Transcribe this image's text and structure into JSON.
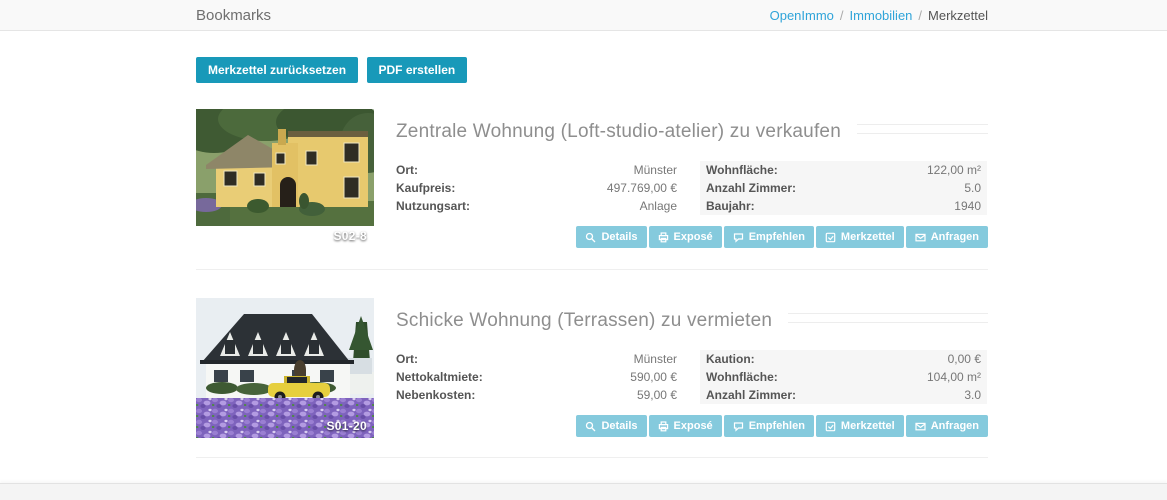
{
  "header": {
    "title": "Bookmarks",
    "separator": "/",
    "breadcrumb": [
      {
        "label": "OpenImmo"
      },
      {
        "label": "Immobilien"
      },
      {
        "label": "Merkzettel"
      }
    ]
  },
  "toolbar": {
    "reset_label": "Merkzettel zurücksetzen",
    "pdf_label": "PDF erstellen"
  },
  "listings": [
    {
      "title": "Zentrale Wohnung (Loft-studio-atelier) zu verkaufen",
      "photo_label": "S02-8",
      "details_left": [
        {
          "label": "Ort:",
          "value": "Münster"
        },
        {
          "label": "Kaufpreis:",
          "value": "497.769,00 €"
        },
        {
          "label": "Nutzungsart:",
          "value": "Anlage"
        }
      ],
      "details_right": [
        {
          "label": "Wohnfläche:",
          "value": "122,00 m²"
        },
        {
          "label": "Anzahl Zimmer:",
          "value": "5.0"
        },
        {
          "label": "Baujahr:",
          "value": "1940"
        }
      ]
    },
    {
      "title": "Schicke Wohnung (Terrassen) zu vermieten",
      "photo_label": "S01-20",
      "details_left": [
        {
          "label": "Ort:",
          "value": "Münster"
        },
        {
          "label": "Nettokaltmiete:",
          "value": "590,00 €"
        },
        {
          "label": "Nebenkosten:",
          "value": "59,00 €"
        }
      ],
      "details_right": [
        {
          "label": "Kaution:",
          "value": "0,00 €"
        },
        {
          "label": "Wohnfläche:",
          "value": "104,00 m²"
        },
        {
          "label": "Anzahl Zimmer:",
          "value": "3.0"
        }
      ]
    }
  ],
  "actions": [
    {
      "label": "Details",
      "icon": "magnifier-icon"
    },
    {
      "label": "Exposé",
      "icon": "printer-icon"
    },
    {
      "label": "Empfehlen",
      "icon": "speech-bubble-icon"
    },
    {
      "label": "Merkzettel",
      "icon": "check-square-icon"
    },
    {
      "label": "Anfragen",
      "icon": "envelope-icon"
    }
  ],
  "colors": {
    "primary_button": "#1899b9",
    "action_button": "#85cadd",
    "link_blue": "#2fa4d9",
    "title_gray": "#8e8e8e",
    "footer_gray": "#f4f4f4"
  }
}
